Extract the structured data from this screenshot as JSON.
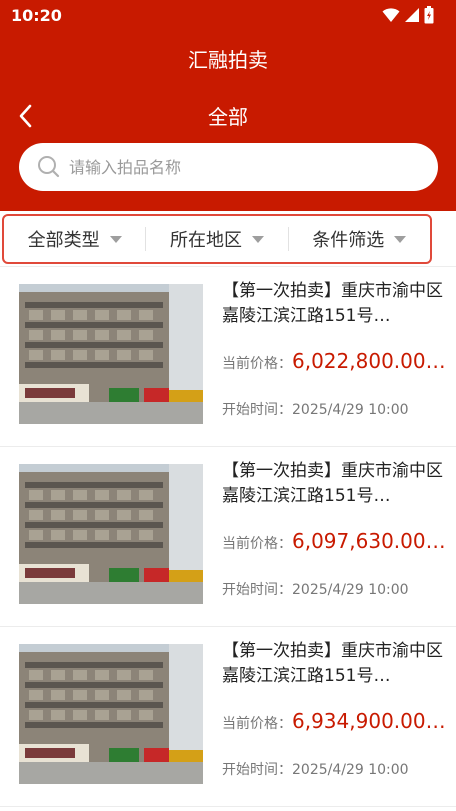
{
  "status_bar": {
    "time": "10:20"
  },
  "header": {
    "app_title": "汇融拍卖",
    "page_title": "全部"
  },
  "search": {
    "placeholder": "请输入拍品名称"
  },
  "filters": [
    {
      "label": "全部类型"
    },
    {
      "label": "所在地区"
    },
    {
      "label": "条件筛选"
    }
  ],
  "items": [
    {
      "title": "【第一次拍卖】重庆市渝中区嘉陵江滨江路151号…",
      "price_label": "当前价格：",
      "price": "6,022,800.00…",
      "start_time_label": "开始时间：",
      "start_time": "2025/4/29 10:00"
    },
    {
      "title": "【第一次拍卖】重庆市渝中区嘉陵江滨江路151号…",
      "price_label": "当前价格：",
      "price": "6,097,630.00…",
      "start_time_label": "开始时间：",
      "start_time": "2025/4/29 10:00"
    },
    {
      "title": "【第一次拍卖】重庆市渝中区嘉陵江滨江路151号…",
      "price_label": "当前价格：",
      "price": "6,934,900.00…",
      "start_time_label": "开始时间：",
      "start_time": "2025/4/29 10:00"
    }
  ],
  "colors": {
    "brand_red": "#c81a00",
    "highlight_border": "#e0493a"
  }
}
